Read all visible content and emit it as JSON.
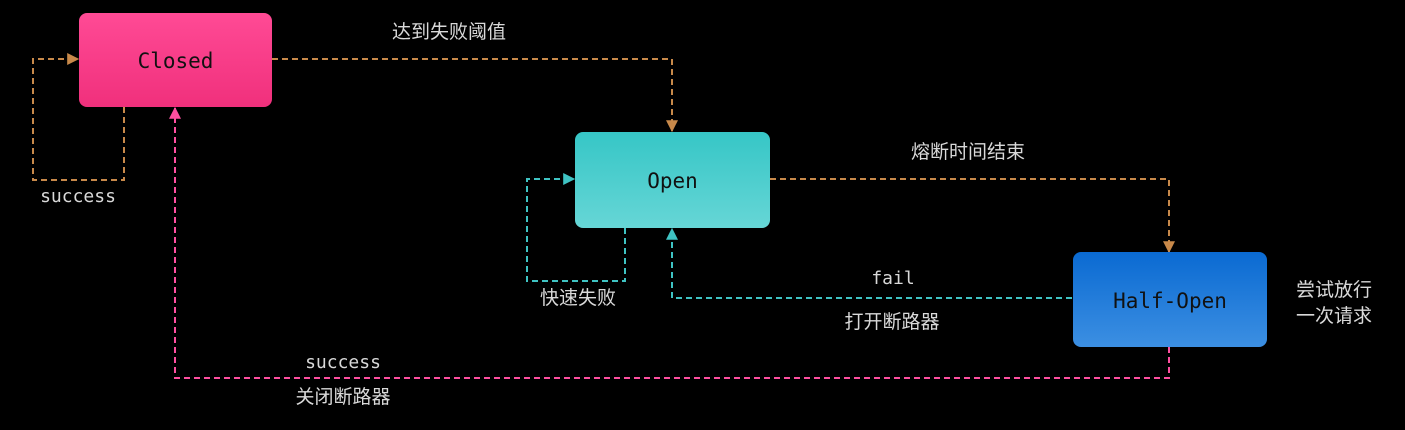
{
  "states": {
    "closed": {
      "label": "Closed",
      "fill": "#ff3f8e"
    },
    "open": {
      "label": "Open",
      "fill": "#42c9c9"
    },
    "half_open": {
      "label": "Half-Open",
      "fill": "#1676d6"
    }
  },
  "transitions": {
    "closed_to_open": "达到失败阈值",
    "closed_self": "success",
    "open_to_half_open": "熔断时间结束",
    "open_self": "快速失败",
    "half_open_fail_top": "fail",
    "half_open_fail_bottom": "打开断路器",
    "half_open_note_line1": "尝试放行",
    "half_open_note_line2": "一次请求",
    "half_open_success_top": "success",
    "half_open_success_bottom": "关闭断路器"
  },
  "colors": {
    "orange_edge": "#c8894a",
    "teal_edge": "#3fc3c3",
    "pink_edge": "#ff4fa0",
    "label_text": "#d9d9d9",
    "background": "#000000"
  }
}
